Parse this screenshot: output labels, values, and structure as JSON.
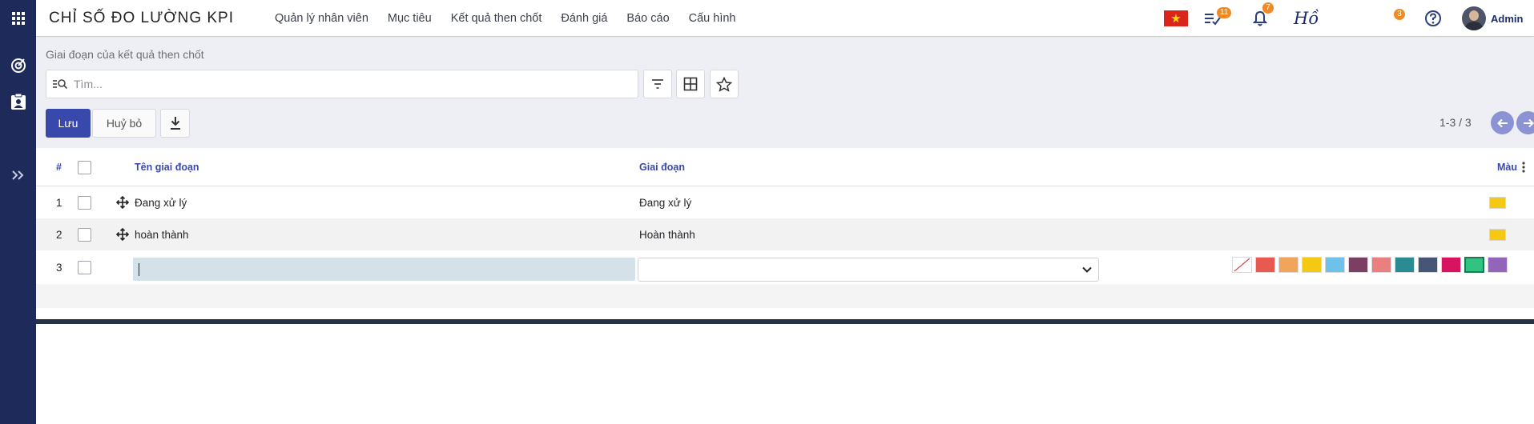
{
  "app": {
    "title": "CHỈ SỐ ĐO LƯỜNG KPI"
  },
  "menu": [
    "Quản lý nhân viên",
    "Mục tiêu",
    "Kết quả then chốt",
    "Đánh giá",
    "Báo cáo",
    "Cấu hình"
  ],
  "systray": {
    "activity_count": "11",
    "notification_count": "7",
    "chat_count": "3",
    "signature_text": "Hồ",
    "user_name": "Admin"
  },
  "breadcrumb": "Giai đoạn của kết quả then chốt",
  "search": {
    "placeholder": "Tìm..."
  },
  "buttons": {
    "save": "Lưu",
    "cancel": "Huỷ bỏ"
  },
  "pager": {
    "text": "1-3 / 3"
  },
  "table": {
    "headers": {
      "index": "#",
      "name": "Tên giai đoạn",
      "stage": "Giai đoạn",
      "color": "Màu"
    },
    "rows": [
      {
        "index": "1",
        "name": "Đang xử lý",
        "stage": "Đang xử lý",
        "color": "#f5c814"
      },
      {
        "index": "2",
        "name": "hoàn thành",
        "stage": "Hoàn thành",
        "color": "#f5c814"
      },
      {
        "index": "3",
        "name": "",
        "stage": "",
        "color": ""
      }
    ],
    "palette": [
      "none",
      "#e85a4f",
      "#f0a55a",
      "#f5c814",
      "#6ec1e8",
      "#7b3f61",
      "#e97f7f",
      "#2a8b92",
      "#475577",
      "#d6145f",
      "#30c381",
      "#9365b8"
    ]
  },
  "colors": {
    "accent": "#3949ab",
    "rail": "#1e2a5a",
    "badge": "#f08a24"
  }
}
